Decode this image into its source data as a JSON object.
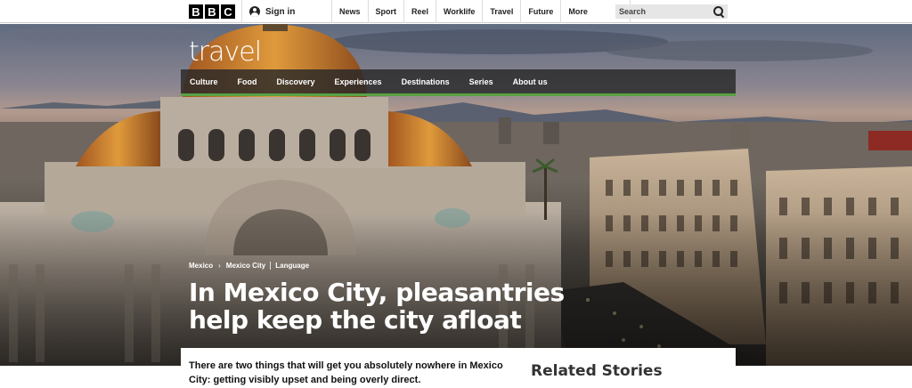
{
  "global_nav": {
    "logo_letters": [
      "B",
      "B",
      "C"
    ],
    "signin_label": "Sign in",
    "items": [
      {
        "label": "News"
      },
      {
        "label": "Sport"
      },
      {
        "label": "Reel"
      },
      {
        "label": "Worklife"
      },
      {
        "label": "Travel"
      },
      {
        "label": "Future"
      },
      {
        "label": "More"
      }
    ],
    "search_placeholder": "Search"
  },
  "travel": {
    "logo": "travel",
    "nav": [
      {
        "label": "Culture"
      },
      {
        "label": "Food"
      },
      {
        "label": "Discovery"
      },
      {
        "label": "Experiences"
      },
      {
        "label": "Destinations"
      },
      {
        "label": "Series"
      },
      {
        "label": "About us"
      }
    ],
    "accent_color": "#58a144"
  },
  "article": {
    "breadcrumb": [
      "Mexico",
      "Mexico City",
      "Language"
    ],
    "headline": "In Mexico City, pleasantries help keep the city afloat",
    "summary": "There are two things that will get you absolutely nowhere in Mexico City: getting visibly upset and being overly direct.",
    "related_heading": "Related Stories"
  }
}
